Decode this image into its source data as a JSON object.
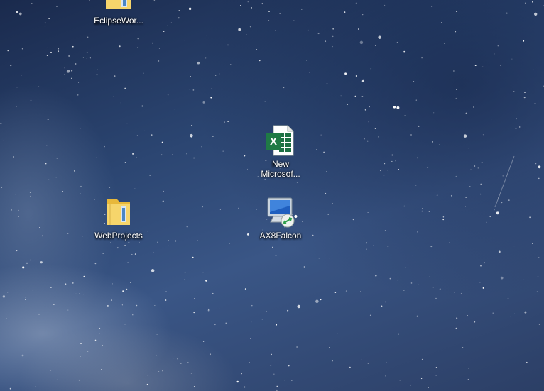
{
  "desktop": {
    "icons": [
      {
        "label": "EclipseWor...",
        "icon": "folder-icon"
      },
      {
        "label": "New\nMicrosof...",
        "icon": "excel-file-icon"
      },
      {
        "label": "WebProjects",
        "icon": "folder-icon"
      },
      {
        "label": "AX8Falcon",
        "icon": "remote-desktop-icon"
      }
    ]
  }
}
